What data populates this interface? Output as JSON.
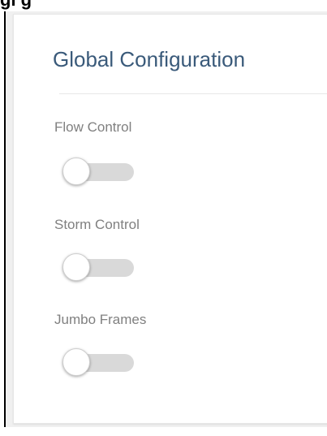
{
  "header": {
    "partial_heading": "gl                              g"
  },
  "panel": {
    "title": "Global Configuration",
    "settings": [
      {
        "label": "Flow Control",
        "enabled": false
      },
      {
        "label": "Storm Control",
        "enabled": false
      },
      {
        "label": "Jumbo Frames",
        "enabled": false
      }
    ]
  },
  "colors": {
    "title": "#3a5a7a",
    "label": "#808080",
    "toggle_off_track": "#d9d9d9",
    "toggle_knob": "#ffffff"
  }
}
